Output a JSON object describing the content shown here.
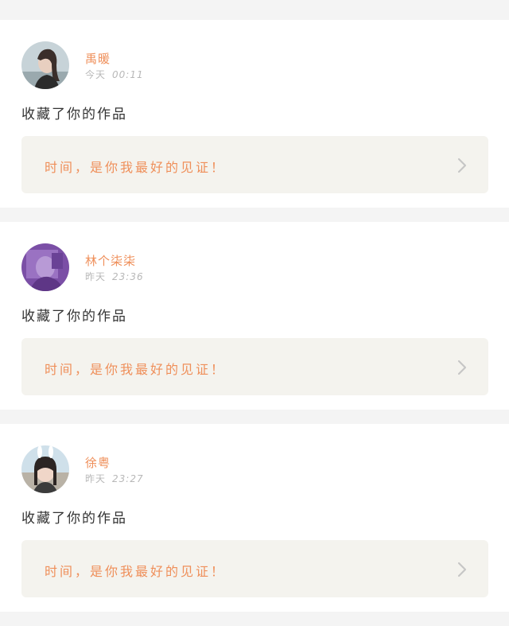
{
  "feed": {
    "items": [
      {
        "username": "禹暖",
        "day": "今天",
        "time": "00:11",
        "action": "收藏了你的作品",
        "link_text": "时间，是你我最好的见证！",
        "avatar_icon": "user-avatar-photo"
      },
      {
        "username": "林个柒柒",
        "day": "昨天",
        "time": "23:36",
        "action": "收藏了你的作品",
        "link_text": "时间，是你我最好的见证！",
        "avatar_icon": "user-avatar-photo"
      },
      {
        "username": "徐粤",
        "day": "昨天",
        "time": "23:27",
        "action": "收藏了你的作品",
        "link_text": "时间，是你我最好的见证！",
        "avatar_icon": "user-avatar-photo"
      }
    ]
  },
  "colors": {
    "accent": "#ef8f5a",
    "page_background": "#f4f4f4",
    "card_background": "#ffffff",
    "link_background": "#f4f3ee",
    "muted_text": "#b8b8b8"
  }
}
